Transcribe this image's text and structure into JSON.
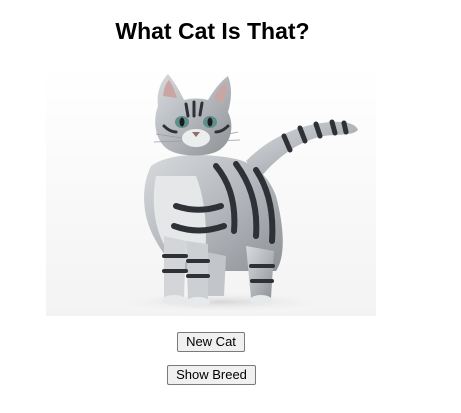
{
  "page": {
    "title": "What Cat Is That?"
  },
  "photo": {
    "subject": "silver tabby cat",
    "background_color": "#fdfdfd",
    "fur_colors": [
      "#c9cbce",
      "#9fa3a8",
      "#2e3136",
      "#e8e9eb"
    ],
    "eye_color": "#5f8f8a"
  },
  "buttons": {
    "new_cat": "New Cat",
    "show_breed": "Show Breed"
  }
}
